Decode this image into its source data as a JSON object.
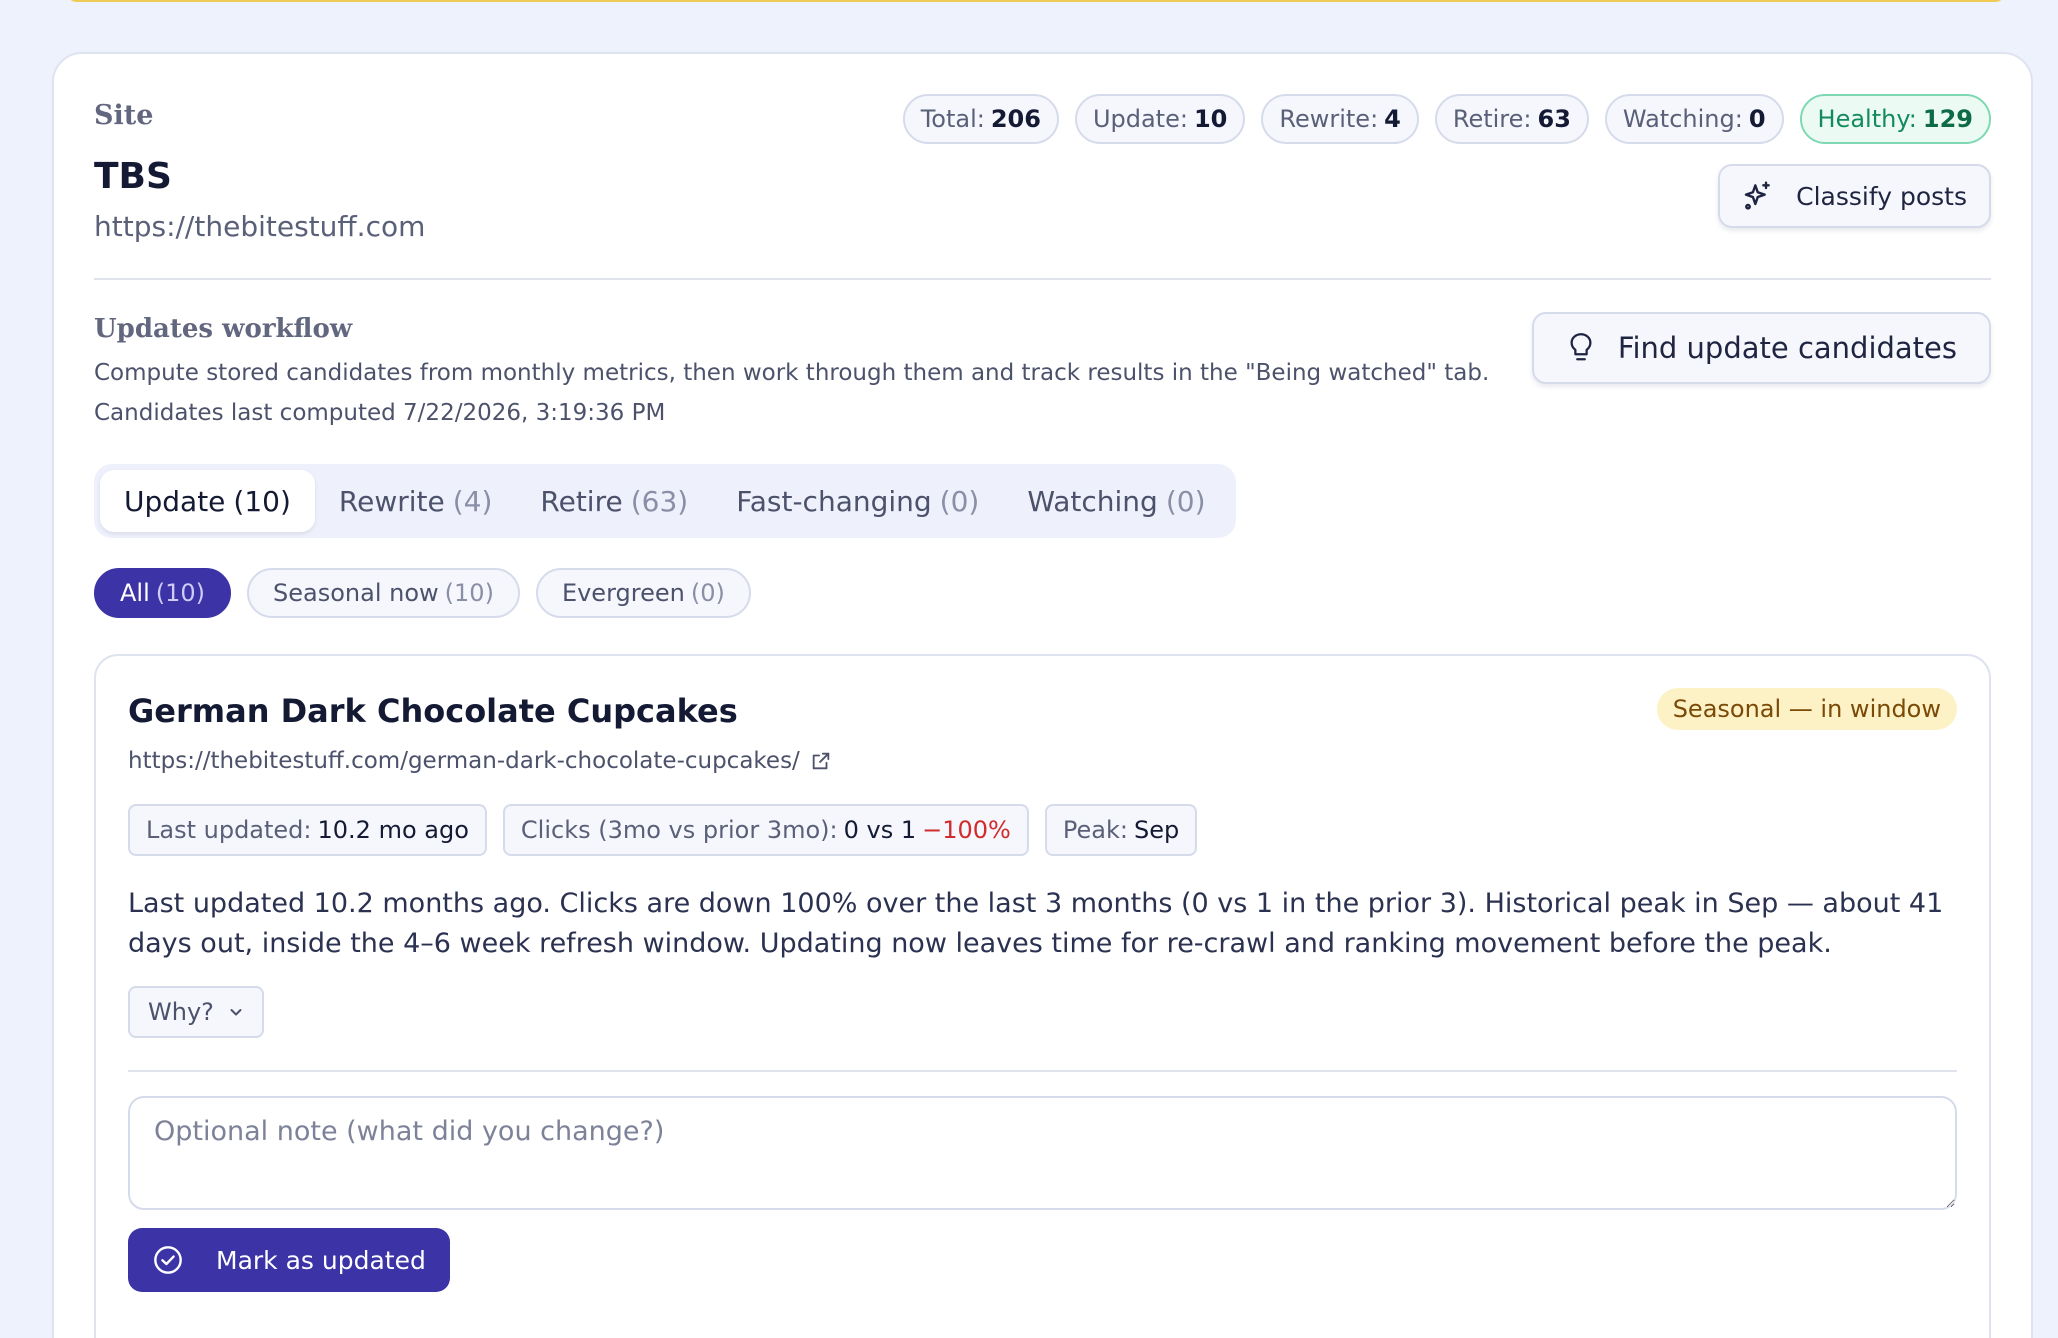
{
  "site": {
    "label": "Site",
    "name": "TBS",
    "url": "https://thebitestuff.com",
    "classify_label": "Classify posts"
  },
  "stats": [
    {
      "label": "Total:",
      "value": "206"
    },
    {
      "label": "Update:",
      "value": "10"
    },
    {
      "label": "Rewrite:",
      "value": "4"
    },
    {
      "label": "Retire:",
      "value": "63"
    },
    {
      "label": "Watching:",
      "value": "0"
    },
    {
      "label": "Healthy:",
      "value": "129"
    }
  ],
  "workflow": {
    "title": "Updates workflow",
    "description": "Compute stored candidates from monthly metrics, then work through them and track results in the \"Being watched\" tab.",
    "computed": "Candidates last computed 7/22/2026, 3:19:36 PM",
    "find_label": "Find update candidates"
  },
  "tabs": [
    {
      "label": "Update",
      "count": "(10)"
    },
    {
      "label": "Rewrite",
      "count": "(4)"
    },
    {
      "label": "Retire",
      "count": "(63)"
    },
    {
      "label": "Fast-changing",
      "count": "(0)"
    },
    {
      "label": "Watching",
      "count": "(0)"
    }
  ],
  "filters": [
    {
      "label": "All",
      "count": "(10)"
    },
    {
      "label": "Seasonal now",
      "count": "(10)"
    },
    {
      "label": "Evergreen",
      "count": "(0)"
    }
  ],
  "post": {
    "title": "German Dark Chocolate Cupcakes",
    "url": "https://thebitestuff.com/german-dark-chocolate-cupcakes/",
    "badge": "Seasonal — in window",
    "metrics": {
      "last_updated_label": "Last updated:",
      "last_updated_value": "10.2 mo ago",
      "clicks_label": "Clicks (3mo vs prior 3mo):",
      "clicks_value": "0 vs 1",
      "clicks_change": "−100%",
      "peak_label": "Peak:",
      "peak_value": "Sep"
    },
    "summary": "Last updated 10.2 months ago. Clicks are down 100% over the last 3 months (0 vs 1 in the prior 3). Historical peak in Sep — about 41 days out, inside the 4–6 week refresh window. Updating now leaves time for re-crawl and ranking movement before the peak.",
    "why_label": "Why?",
    "note_placeholder": "Optional note (what did you change?)",
    "mark_label": "Mark as updated"
  },
  "colors": {
    "primary": "#3b33a6",
    "healthy": "#148a5f",
    "negative": "#d12b2b",
    "seasonal_bg": "#fdf1c6"
  }
}
